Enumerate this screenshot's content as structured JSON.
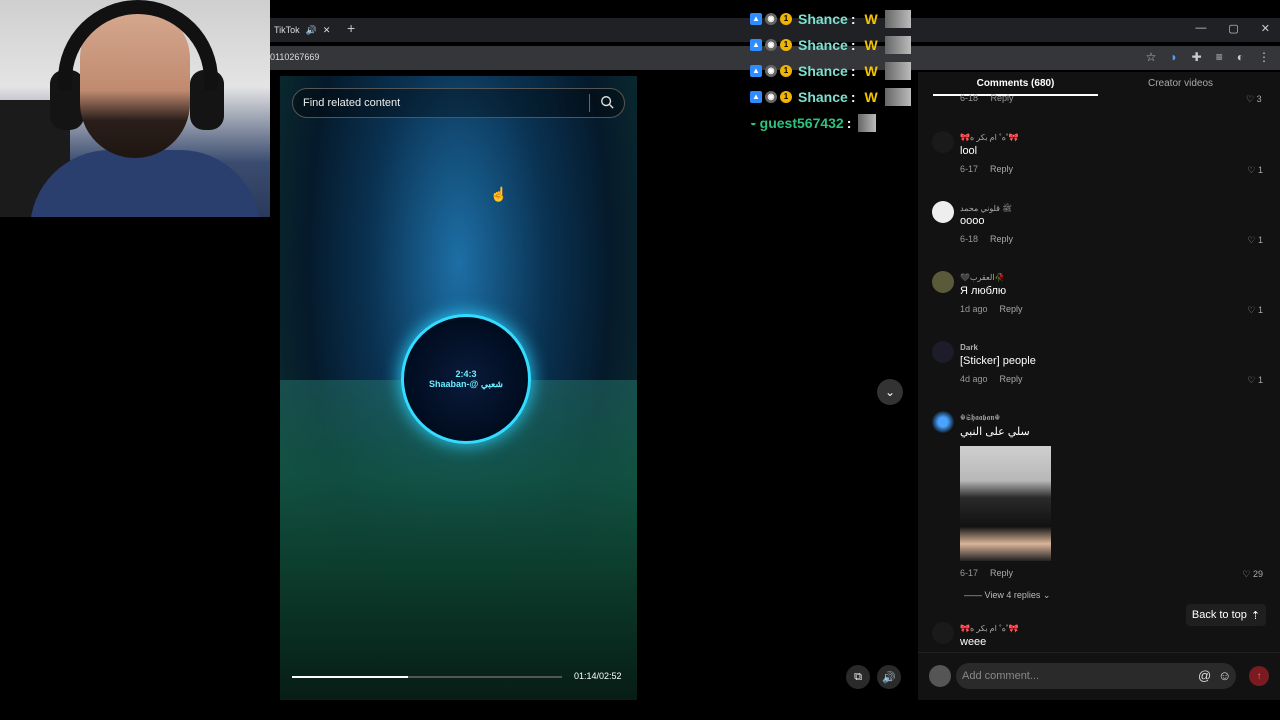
{
  "browser": {
    "tab_title": "TikTok",
    "url_fragment": "0110267669",
    "new_tab": "+",
    "window_controls": [
      "—",
      "▢",
      "✕"
    ]
  },
  "video": {
    "search_placeholder": "Find related content",
    "time": "01:14/02:52",
    "progress_fraction": 0.43,
    "logo_text_line1": "2:4:3",
    "logo_text_line2": "Shaaban-@ شعبي"
  },
  "chat": {
    "rows": [
      {
        "name": "Shance",
        "sep": ":",
        "msg": "W"
      },
      {
        "name": "Shance",
        "sep": ":",
        "msg": "W"
      },
      {
        "name": "Shance",
        "sep": ":",
        "msg": "W"
      },
      {
        "name": "Shance",
        "sep": ":",
        "msg": "W"
      }
    ],
    "guest": {
      "name": "guest567432",
      "sep": ":"
    }
  },
  "panel": {
    "tab_comments": "Comments (680)",
    "tab_creator": "Creator videos",
    "top_partial": {
      "date": "6-18",
      "reply": "Reply",
      "likes": "3"
    },
    "comments": [
      {
        "name": "🎀ه˚ ام بكر ه˚🎀",
        "text": "lool",
        "date": "6-17",
        "reply": "Reply",
        "likes": "1"
      },
      {
        "name": "ﷺ قلوني محمد",
        "text": "oooo",
        "date": "6-18",
        "reply": "Reply",
        "likes": "1"
      },
      {
        "name": "🖤العقرب🥀",
        "text": "Я люблю",
        "date": "1d ago",
        "reply": "Reply",
        "likes": "1"
      },
      {
        "name": "𝐃𝐚𝐫𝐤",
        "text": "[Sticker] people",
        "date": "4d ago",
        "reply": "Reply",
        "likes": "1"
      },
      {
        "name": "☬𝕾𝖍𝖆𝖆𝖇𝖆𝖓☬",
        "text": "سلي على النبي",
        "date": "6-17",
        "reply": "Reply",
        "likes": "29"
      },
      {
        "name": "🎀ه˚ ام بكر ه˚🎀",
        "text": "weee"
      }
    ],
    "view_replies": "View 4 replies",
    "back_to_top": "Back to top",
    "composer_placeholder": "Add comment..."
  }
}
